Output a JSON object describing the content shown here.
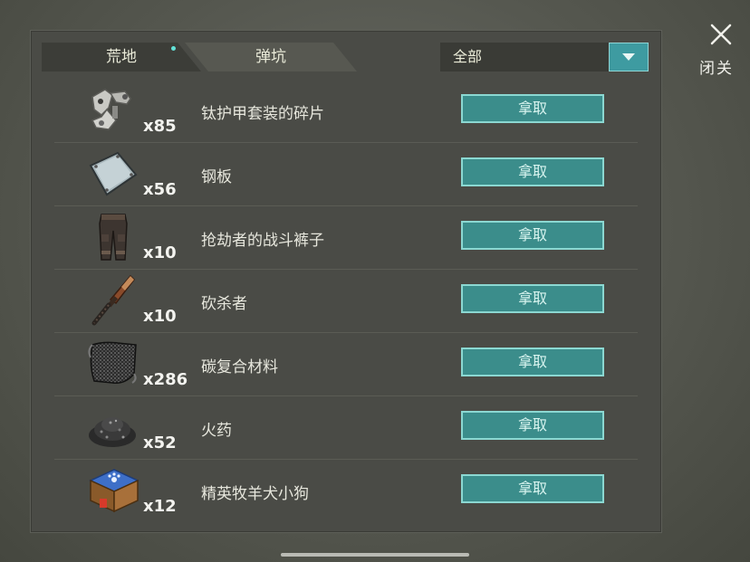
{
  "tabs": [
    {
      "label": "荒地",
      "active": true
    },
    {
      "label": "弹坑",
      "active": false
    }
  ],
  "filter": {
    "selected": "全部"
  },
  "close": {
    "label": "关闭"
  },
  "items": [
    {
      "icon": "titanium-armor-fragment-icon",
      "qty": "x85",
      "name": "钛护甲套装的碎片",
      "action": "拿取"
    },
    {
      "icon": "steel-plate-icon",
      "qty": "x56",
      "name": "钢板",
      "action": "拿取"
    },
    {
      "icon": "combat-pants-icon",
      "qty": "x10",
      "name": "抢劫者的战斗裤子",
      "action": "拿取"
    },
    {
      "icon": "machete-icon",
      "qty": "x10",
      "name": "砍杀者",
      "action": "拿取"
    },
    {
      "icon": "carbon-fiber-icon",
      "qty": "x286",
      "name": "碳复合材料",
      "action": "拿取"
    },
    {
      "icon": "gunpowder-icon",
      "qty": "x52",
      "name": "火药",
      "action": "拿取"
    },
    {
      "icon": "elite-shepherd-puppy-icon",
      "qty": "x12",
      "name": "精英牧羊犬小狗",
      "action": "拿取"
    }
  ],
  "colors": {
    "accent": "#3e9ba1",
    "button": "#3b8d8b",
    "panel": "#4a4b46"
  }
}
